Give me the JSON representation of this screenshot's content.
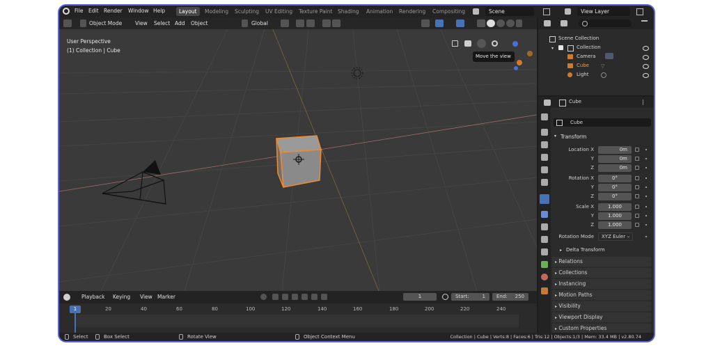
{
  "menu": [
    "File",
    "Edit",
    "Render",
    "Window",
    "Help"
  ],
  "workspaces": {
    "active": "Layout",
    "others": [
      "Modeling",
      "Sculpting",
      "UV Editing",
      "Texture Paint",
      "Shading",
      "Animation",
      "Rendering",
      "Compositing"
    ]
  },
  "scene": {
    "label": "Scene",
    "view_layer": "View Layer"
  },
  "viewport": {
    "mode": "Object Mode",
    "menus": [
      "View",
      "Select",
      "Add",
      "Object"
    ],
    "orientation": "Global",
    "overlay_title": "User Perspective",
    "overlay_subtitle": "(1) Collection | Cube",
    "tooltip": "Move the view"
  },
  "outliner": {
    "root": "Scene Collection",
    "collection": "Collection",
    "items": [
      "Camera",
      "Cube",
      "Light"
    ]
  },
  "properties": {
    "object_name": "Cube",
    "data_name": "Cube",
    "transform_title": "Transform",
    "location": {
      "label": "Location X",
      "x": "0m",
      "y": "0m",
      "z": "0m"
    },
    "rotation": {
      "label": "Rotation X",
      "x": "0°",
      "y": "0°",
      "z": "0°"
    },
    "scale": {
      "label": "Scale X",
      "x": "1.000",
      "y": "1.000",
      "z": "1.000"
    },
    "axis_y": "Y",
    "axis_z": "Z",
    "rotation_mode_label": "Rotation Mode",
    "rotation_mode_value": "XYZ Euler",
    "delta_transform": "Delta Transform",
    "panels": [
      "Relations",
      "Collections",
      "Instancing",
      "Motion Paths",
      "Visibility",
      "Viewport Display",
      "Custom Properties"
    ]
  },
  "timeline": {
    "menus": [
      "Playback",
      "Keying",
      "View",
      "Marker"
    ],
    "current_frame": "1",
    "start_label": "Start:",
    "start_value": "1",
    "end_label": "End:",
    "end_value": "250",
    "ticks": [
      "20",
      "40",
      "60",
      "80",
      "100",
      "120",
      "140",
      "160",
      "180",
      "200",
      "220",
      "240"
    ],
    "playhead": "1"
  },
  "statusbar": {
    "select": "Select",
    "box_select": "Box Select",
    "rotate_view": "Rotate View",
    "context_menu": "Object Context Menu",
    "stats": "Collection | Cube | Verts:8 | Faces:6 | Tris:12 | Objects:1/3 | Mem: 33.4 MB | v2.80.74"
  },
  "colors": {
    "accent": "#4772b3",
    "selection": "#f08a2c",
    "frame": "#5a62e6"
  }
}
